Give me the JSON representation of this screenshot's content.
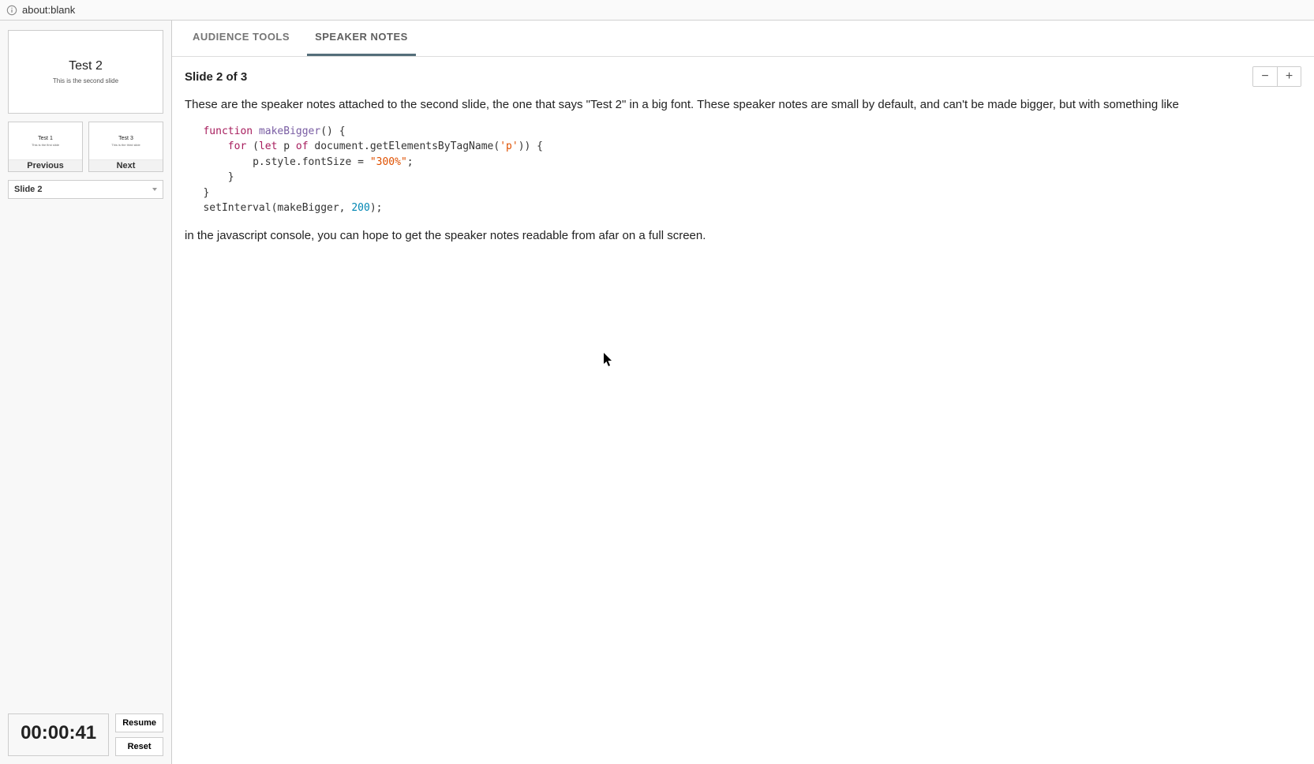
{
  "browser": {
    "url": "about:blank"
  },
  "sidebar": {
    "current": {
      "title": "Test 2",
      "subtitle": "This is the second slide"
    },
    "prev": {
      "thumb_title": "Test 1",
      "thumb_sub": "This is the first slide",
      "label": "Previous"
    },
    "next": {
      "thumb_title": "Test 3",
      "thumb_sub": "This is the third slide",
      "label": "Next"
    },
    "selector": "Slide 2",
    "timer": {
      "value": "00:00:41",
      "resume": "Resume",
      "reset": "Reset"
    }
  },
  "tabs": {
    "audience": "AUDIENCE TOOLS",
    "speaker": "SPEAKER NOTES"
  },
  "notes": {
    "heading": "Slide 2 of 3",
    "para1": "These are the speaker notes attached to the second slide, the one that says \"Test 2\" in a big font. These speaker notes are small by default, and can't be made bigger, but with something like",
    "para2": "in the javascript console, you can hope to get the speaker notes readable from afar on a full screen.",
    "code": {
      "l1_kw1": "function",
      "l1_fn": "makeBigger",
      "l1_rest": "() {",
      "l2_kw1": "for",
      "l2_open": " (",
      "l2_kw2": "let",
      "l2_var": " p ",
      "l2_kw3": "of",
      "l2_expr": " document.getElementsByTagName(",
      "l2_str": "'p'",
      "l2_close": ")) {",
      "l3_expr": "p.style.fontSize = ",
      "l3_str": "\"300%\"",
      "l3_end": ";",
      "l4": "}",
      "l5": "}",
      "l6_expr": "setInterval(makeBigger, ",
      "l6_num": "200",
      "l6_end": ");"
    }
  },
  "zoom": {
    "minus": "−",
    "plus": "+"
  }
}
